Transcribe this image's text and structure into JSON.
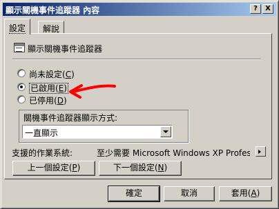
{
  "window": {
    "title": "顯示關機事件追蹤器 內容",
    "help_label": "?",
    "close_label": "X"
  },
  "tabs": [
    {
      "label": "設定",
      "active": true
    },
    {
      "label": "解說",
      "active": false
    }
  ],
  "policy": {
    "icon": "policy-setting-icon",
    "name": "顯示關機事件追蹤器"
  },
  "options": [
    {
      "label": "尚未設定",
      "key": "C",
      "checked": false
    },
    {
      "label": "已啟用",
      "key": "E",
      "checked": true
    },
    {
      "label": "已停用",
      "key": "D",
      "checked": false
    }
  ],
  "annotation": {
    "color": "#ff0000",
    "icon": "red-arrow"
  },
  "display_mode": {
    "label": "關機事件追蹤器顯示方式:",
    "value": "一直顯示"
  },
  "supported": {
    "label": "支援的作業系統:",
    "value": "至少需要 Microsoft Windows XP Professional 或 ..."
  },
  "nav": {
    "prev_label": "上一個設定",
    "prev_key": "P",
    "next_label": "下一個設定",
    "next_key": "N"
  },
  "footer": {
    "ok_label": "確定",
    "cancel_label": "取消",
    "apply_label": "套用",
    "apply_key": "A"
  }
}
